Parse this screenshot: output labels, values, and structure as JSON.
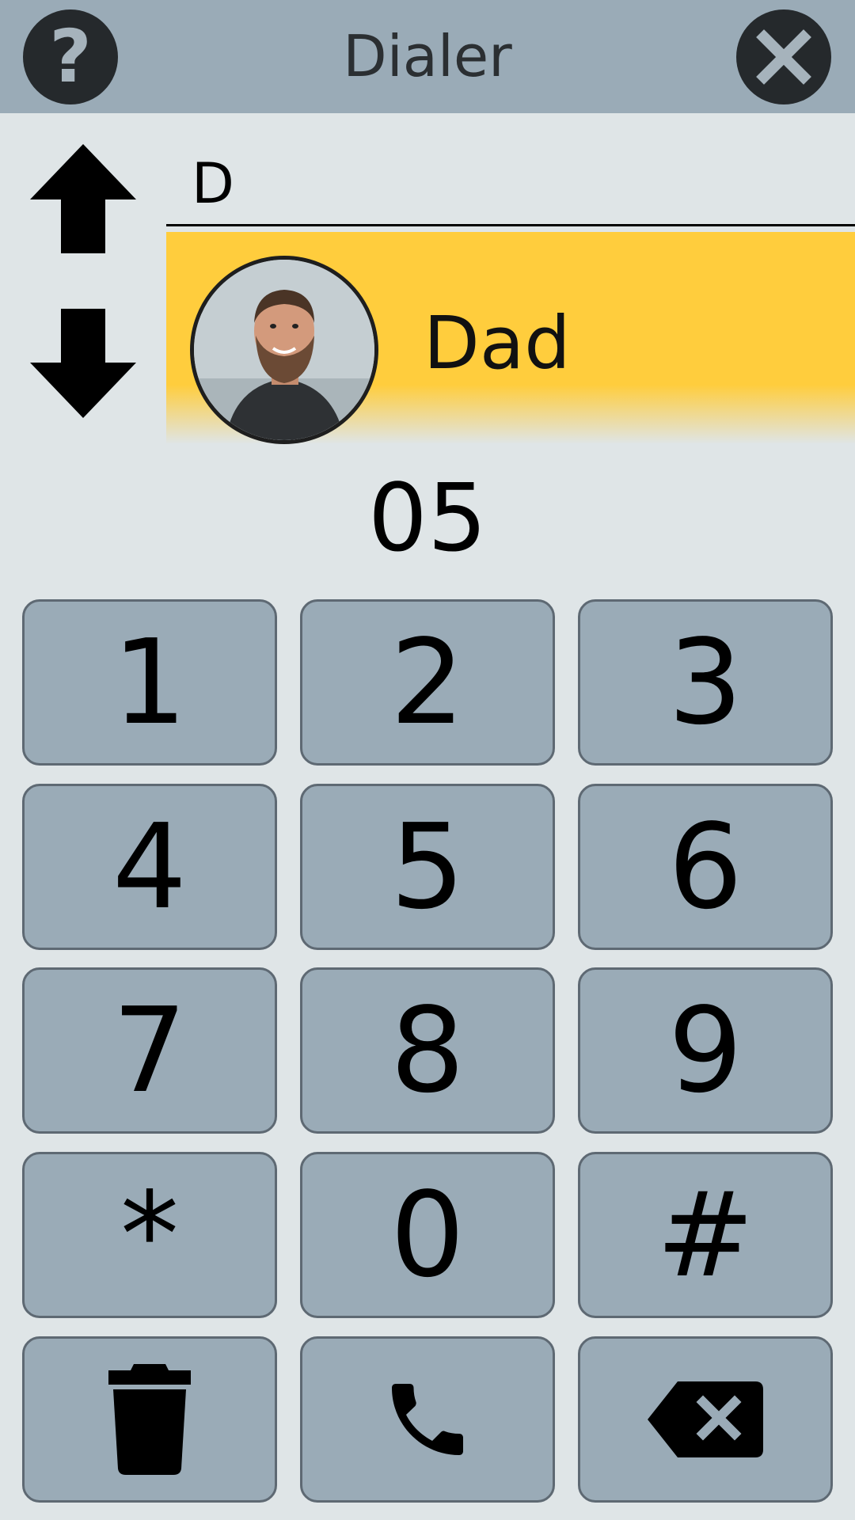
{
  "header": {
    "title": "Dialer",
    "help_icon": "question-mark-icon",
    "close_icon": "close-x-icon",
    "background": "#9aabb7"
  },
  "navigation": {
    "up_icon": "arrow-up-icon",
    "down_icon": "arrow-down-icon"
  },
  "search": {
    "value": "D"
  },
  "contact": {
    "name": "Dad",
    "highlight_color": "#ffcd3d",
    "avatar_icon": "contact-photo"
  },
  "dialed_number": "05",
  "keypad": {
    "keys": [
      "1",
      "2",
      "3",
      "4",
      "5",
      "6",
      "7",
      "8",
      "9",
      "*",
      "0",
      "#"
    ],
    "bottom_row": {
      "clear_icon": "trash-icon",
      "call_icon": "phone-icon",
      "backspace_icon": "backspace-icon"
    },
    "key_color": "#9aabb7"
  }
}
